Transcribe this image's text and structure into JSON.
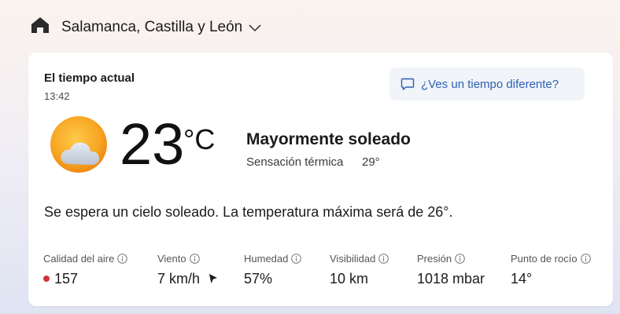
{
  "header": {
    "home_icon": "home-icon",
    "location": "Salamanca, Castilla y León"
  },
  "card": {
    "title": "El tiempo actual",
    "time": "13:42",
    "feedback_button": "¿Ves un tiempo diferente?",
    "current": {
      "temperature": "23",
      "unit": "°C",
      "condition": "Mayormente soleado",
      "feels_like_label": "Sensación térmica",
      "feels_like_value": "29°",
      "icon": "partly-sunny-icon"
    },
    "summary": "Se espera un cielo soleado. La temperatura máxima será de 26°.",
    "metrics": [
      {
        "label": "Calidad del aire",
        "value": "157"
      },
      {
        "label": "Viento",
        "value": "7 km/h"
      },
      {
        "label": "Humedad",
        "value": "57%"
      },
      {
        "label": "Visibilidad",
        "value": "10 km"
      },
      {
        "label": "Presión",
        "value": "1018 mbar"
      },
      {
        "label": "Punto de rocío",
        "value": "14°"
      }
    ]
  },
  "colors": {
    "accent": "#2c5fb5",
    "sun": "#f5a623",
    "aqi_status": "#d1343b"
  }
}
